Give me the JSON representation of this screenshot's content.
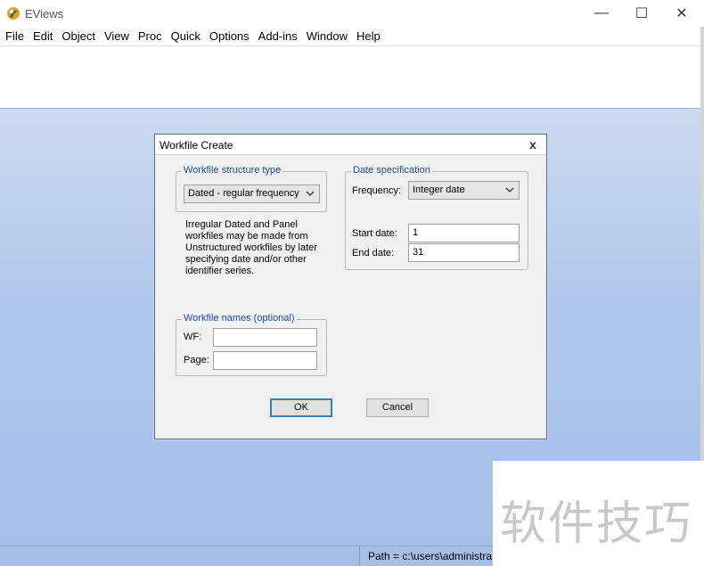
{
  "window": {
    "title": "EViews",
    "controls": {
      "minimize": "—",
      "maximize": "☐",
      "close": "✕"
    }
  },
  "menu": [
    "File",
    "Edit",
    "Object",
    "View",
    "Proc",
    "Quick",
    "Options",
    "Add-ins",
    "Window",
    "Help"
  ],
  "dialog": {
    "title": "Workfile Create",
    "close": "x",
    "structure": {
      "legend": "Workfile structure type",
      "selected": "Dated - regular frequency"
    },
    "info_lines": [
      "Irregular Dated and Panel",
      "workfiles may be made from",
      "Unstructured workfiles by later",
      "specifying date and/or other",
      "identifier series."
    ],
    "date_spec": {
      "legend": "Date specification",
      "frequency_label": "Frequency:",
      "frequency_value": "Integer date",
      "start_label": "Start date:",
      "start_value": "1",
      "end_label": "End date:",
      "end_value": "31"
    },
    "names": {
      "legend": "Workfile names (optional)",
      "wf_label": "WF:",
      "wf_value": "",
      "page_label": "Page:",
      "page_value": ""
    },
    "ok_label": "OK",
    "cancel_label": "Cancel"
  },
  "status": {
    "path": "Path = c:\\users\\administra"
  },
  "watermark": "软件技巧",
  "colors": {
    "workspace": "#b2c9ec",
    "legend_text": "#1e4fa0",
    "status_bar": "#a5bfe6"
  }
}
